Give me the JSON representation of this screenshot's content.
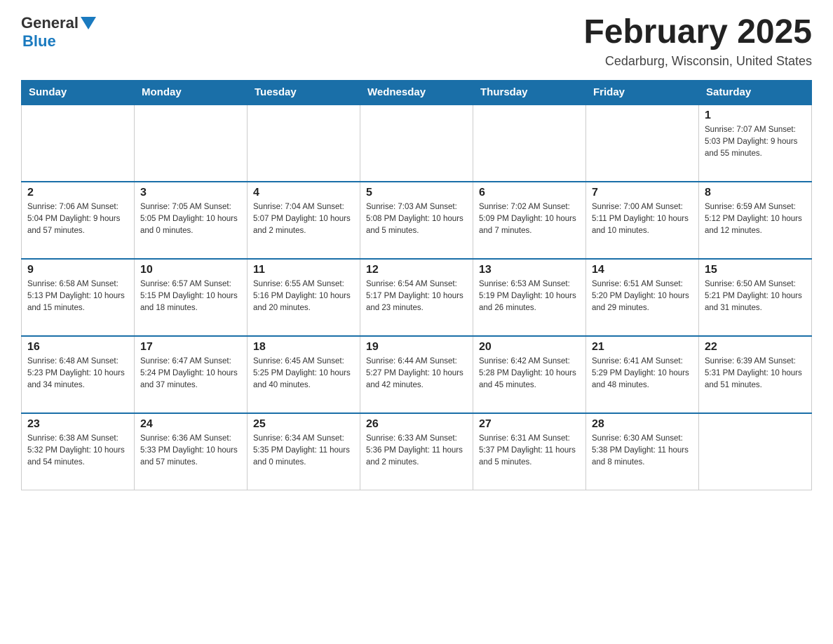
{
  "header": {
    "logo_general": "General",
    "logo_blue": "Blue",
    "month_title": "February 2025",
    "location": "Cedarburg, Wisconsin, United States"
  },
  "days_of_week": [
    "Sunday",
    "Monday",
    "Tuesday",
    "Wednesday",
    "Thursday",
    "Friday",
    "Saturday"
  ],
  "weeks": [
    [
      {
        "day": "",
        "info": ""
      },
      {
        "day": "",
        "info": ""
      },
      {
        "day": "",
        "info": ""
      },
      {
        "day": "",
        "info": ""
      },
      {
        "day": "",
        "info": ""
      },
      {
        "day": "",
        "info": ""
      },
      {
        "day": "1",
        "info": "Sunrise: 7:07 AM\nSunset: 5:03 PM\nDaylight: 9 hours and 55 minutes."
      }
    ],
    [
      {
        "day": "2",
        "info": "Sunrise: 7:06 AM\nSunset: 5:04 PM\nDaylight: 9 hours and 57 minutes."
      },
      {
        "day": "3",
        "info": "Sunrise: 7:05 AM\nSunset: 5:05 PM\nDaylight: 10 hours and 0 minutes."
      },
      {
        "day": "4",
        "info": "Sunrise: 7:04 AM\nSunset: 5:07 PM\nDaylight: 10 hours and 2 minutes."
      },
      {
        "day": "5",
        "info": "Sunrise: 7:03 AM\nSunset: 5:08 PM\nDaylight: 10 hours and 5 minutes."
      },
      {
        "day": "6",
        "info": "Sunrise: 7:02 AM\nSunset: 5:09 PM\nDaylight: 10 hours and 7 minutes."
      },
      {
        "day": "7",
        "info": "Sunrise: 7:00 AM\nSunset: 5:11 PM\nDaylight: 10 hours and 10 minutes."
      },
      {
        "day": "8",
        "info": "Sunrise: 6:59 AM\nSunset: 5:12 PM\nDaylight: 10 hours and 12 minutes."
      }
    ],
    [
      {
        "day": "9",
        "info": "Sunrise: 6:58 AM\nSunset: 5:13 PM\nDaylight: 10 hours and 15 minutes."
      },
      {
        "day": "10",
        "info": "Sunrise: 6:57 AM\nSunset: 5:15 PM\nDaylight: 10 hours and 18 minutes."
      },
      {
        "day": "11",
        "info": "Sunrise: 6:55 AM\nSunset: 5:16 PM\nDaylight: 10 hours and 20 minutes."
      },
      {
        "day": "12",
        "info": "Sunrise: 6:54 AM\nSunset: 5:17 PM\nDaylight: 10 hours and 23 minutes."
      },
      {
        "day": "13",
        "info": "Sunrise: 6:53 AM\nSunset: 5:19 PM\nDaylight: 10 hours and 26 minutes."
      },
      {
        "day": "14",
        "info": "Sunrise: 6:51 AM\nSunset: 5:20 PM\nDaylight: 10 hours and 29 minutes."
      },
      {
        "day": "15",
        "info": "Sunrise: 6:50 AM\nSunset: 5:21 PM\nDaylight: 10 hours and 31 minutes."
      }
    ],
    [
      {
        "day": "16",
        "info": "Sunrise: 6:48 AM\nSunset: 5:23 PM\nDaylight: 10 hours and 34 minutes."
      },
      {
        "day": "17",
        "info": "Sunrise: 6:47 AM\nSunset: 5:24 PM\nDaylight: 10 hours and 37 minutes."
      },
      {
        "day": "18",
        "info": "Sunrise: 6:45 AM\nSunset: 5:25 PM\nDaylight: 10 hours and 40 minutes."
      },
      {
        "day": "19",
        "info": "Sunrise: 6:44 AM\nSunset: 5:27 PM\nDaylight: 10 hours and 42 minutes."
      },
      {
        "day": "20",
        "info": "Sunrise: 6:42 AM\nSunset: 5:28 PM\nDaylight: 10 hours and 45 minutes."
      },
      {
        "day": "21",
        "info": "Sunrise: 6:41 AM\nSunset: 5:29 PM\nDaylight: 10 hours and 48 minutes."
      },
      {
        "day": "22",
        "info": "Sunrise: 6:39 AM\nSunset: 5:31 PM\nDaylight: 10 hours and 51 minutes."
      }
    ],
    [
      {
        "day": "23",
        "info": "Sunrise: 6:38 AM\nSunset: 5:32 PM\nDaylight: 10 hours and 54 minutes."
      },
      {
        "day": "24",
        "info": "Sunrise: 6:36 AM\nSunset: 5:33 PM\nDaylight: 10 hours and 57 minutes."
      },
      {
        "day": "25",
        "info": "Sunrise: 6:34 AM\nSunset: 5:35 PM\nDaylight: 11 hours and 0 minutes."
      },
      {
        "day": "26",
        "info": "Sunrise: 6:33 AM\nSunset: 5:36 PM\nDaylight: 11 hours and 2 minutes."
      },
      {
        "day": "27",
        "info": "Sunrise: 6:31 AM\nSunset: 5:37 PM\nDaylight: 11 hours and 5 minutes."
      },
      {
        "day": "28",
        "info": "Sunrise: 6:30 AM\nSunset: 5:38 PM\nDaylight: 11 hours and 8 minutes."
      },
      {
        "day": "",
        "info": ""
      }
    ]
  ]
}
